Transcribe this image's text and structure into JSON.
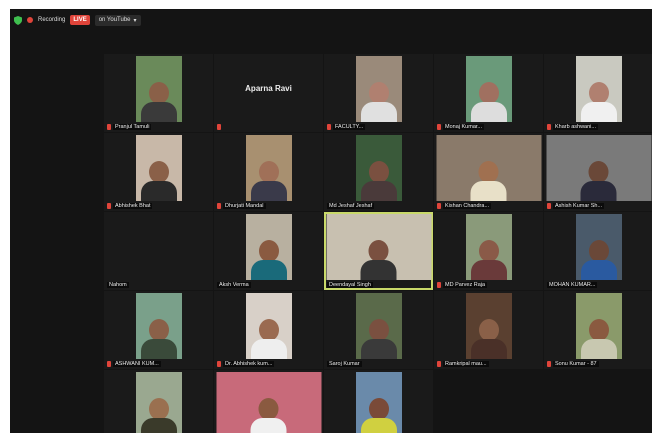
{
  "topbar": {
    "recording_label": "Recording",
    "live_label": "LIVE",
    "stream_label": "on YouTube"
  },
  "tiles": [
    {
      "name": "Pranjul Tamuli",
      "muted": true,
      "bg": "#6a8a5a",
      "skin": "#8a6048",
      "shirt": "#3a3a3a",
      "w": "w-narrow"
    },
    {
      "name": "",
      "center_name": "Aparna Ravi",
      "muted": true,
      "bg": "",
      "w": ""
    },
    {
      "name": "FACULTY...",
      "muted": true,
      "bg": "#9a8a7a",
      "skin": "#b08070",
      "shirt": "#e0e0e0",
      "w": "w-narrow"
    },
    {
      "name": "Monaj Kumar...",
      "muted": true,
      "bg": "#6a9a7a",
      "skin": "#a07060",
      "shirt": "#ddd",
      "w": "w-narrow"
    },
    {
      "name": "Kharb ashwani...",
      "muted": true,
      "bg": "#c9c9c0",
      "skin": "#b08070",
      "shirt": "#f0f0f0",
      "w": "w-narrow"
    },
    {
      "name": "Abhishek Bhat",
      "muted": true,
      "bg": "#c8b8a8",
      "skin": "#8a6048",
      "shirt": "#2a2a2a",
      "w": "w-narrow"
    },
    {
      "name": "Dhurjati Mandal",
      "muted": true,
      "bg": "#a89070",
      "skin": "#a07058",
      "shirt": "#3a3a4a",
      "w": "w-narrow"
    },
    {
      "name": "Md Jeshaf Jeshaf",
      "muted": false,
      "bg": "#3a5a3a",
      "skin": "#7a5040",
      "shirt": "#4a3a3a",
      "w": "w-narrow"
    },
    {
      "name": "Kishan Chandra...",
      "muted": true,
      "bg": "#8a7a6a",
      "skin": "#a07050",
      "shirt": "#e8e0c8",
      "w": "w-wide"
    },
    {
      "name": "Ashish Kumar Sh...",
      "muted": true,
      "bg": "#7a7a7a",
      "skin": "#6a4838",
      "shirt": "#2a2a3a",
      "w": "w-wide"
    },
    {
      "name": "Nahom",
      "muted": false,
      "bg": "",
      "w": ""
    },
    {
      "name": "Aksh Verma",
      "muted": false,
      "bg": "#b8b0a0",
      "skin": "#8a5a40",
      "shirt": "#1a6a7a",
      "w": "w-narrow"
    },
    {
      "name": "Deendayal Singh",
      "muted": false,
      "bg": "#c8c0b0",
      "skin": "#7a5040",
      "shirt": "#333",
      "w": "w-wide",
      "active": true
    },
    {
      "name": "MD Parvez Raja",
      "muted": true,
      "bg": "#8a9a7a",
      "skin": "#8a5a48",
      "shirt": "#6a3a3a",
      "w": "w-narrow"
    },
    {
      "name": "MOHAN KUMAR...",
      "muted": false,
      "bg": "#4a5a6a",
      "skin": "#6a4838",
      "shirt": "#2a5aa0",
      "w": "w-narrow"
    },
    {
      "name": "ASHWANI KUM...",
      "muted": true,
      "bg": "#7aa08a",
      "skin": "#8a6048",
      "shirt": "#3a4a3a",
      "w": "w-narrow"
    },
    {
      "name": "Dr. Abhishek kum...",
      "muted": true,
      "bg": "#d8d0c8",
      "skin": "#9a6a50",
      "shirt": "#eee",
      "w": "w-narrow"
    },
    {
      "name": "Saroj Kumar",
      "muted": false,
      "bg": "#5a6a4a",
      "skin": "#7a5040",
      "shirt": "#3a3a3a",
      "w": "w-narrow"
    },
    {
      "name": "Ramkripal mau...",
      "muted": true,
      "bg": "#5a4030",
      "skin": "#8a6048",
      "shirt": "#4a3028",
      "w": "w-narrow"
    },
    {
      "name": "Sonu Kumar - 87",
      "muted": true,
      "bg": "#8a9a6a",
      "skin": "#8a5a40",
      "shirt": "#c8c8b0",
      "w": "w-narrow"
    },
    {
      "name": "",
      "muted": false,
      "bg": "#9aa890",
      "skin": "#9a7050",
      "shirt": "#3a3a2a",
      "w": "w-narrow"
    },
    {
      "name": "",
      "muted": false,
      "bg": "#c86a7a",
      "skin": "#8a5a40",
      "shirt": "#f0f0f0",
      "w": "w-wide"
    },
    {
      "name": "",
      "muted": false,
      "bg": "#6a8aaa",
      "skin": "#7a4a38",
      "shirt": "#d0d040",
      "w": "w-narrow"
    }
  ]
}
